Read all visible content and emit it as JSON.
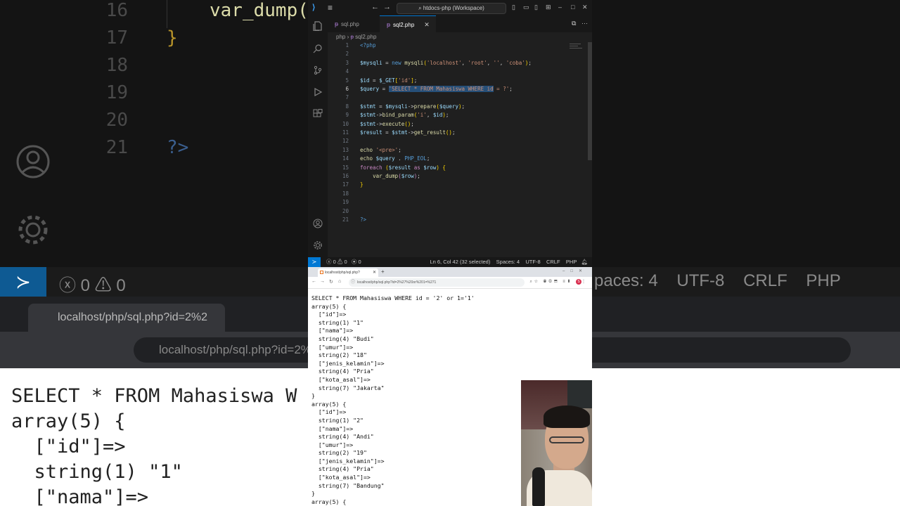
{
  "background": {
    "editor_lines": [
      {
        "num": "16",
        "code": "var_dump("
      },
      {
        "num": "17",
        "code": "}"
      },
      {
        "num": "18",
        "code": ""
      },
      {
        "num": "19",
        "code": ""
      },
      {
        "num": "20",
        "code": ""
      },
      {
        "num": "21",
        "code": "?>"
      }
    ],
    "status_left": "0 ⚠ 0",
    "status_right": "paces: 4    UTF-8    CRLF    PHP",
    "tab_title": "localhost/php/sql.php?id=2%2",
    "url": "localhost/php/sql.php?id=2%",
    "page_text": "SELECT * FROM Mahasiswa W\narray(5) {\n  [\"id\"]=>\n  string(1) \"1\"\n  [\"nama\"]=>"
  },
  "vscode": {
    "search_label": "htdocs-php (Workspace)",
    "tabs": [
      {
        "label": "sql.php",
        "active": false
      },
      {
        "label": "sql2.php",
        "active": true
      }
    ],
    "breadcrumb": {
      "folder": "php",
      "file": "sql2.php"
    },
    "line_numbers": [
      "1",
      "2",
      "3",
      "4",
      "5",
      "6",
      "7",
      "8",
      "9",
      "10",
      "11",
      "12",
      "13",
      "14",
      "15",
      "16",
      "17",
      "18",
      "19",
      "20",
      "21"
    ],
    "current_line": "6",
    "status": {
      "errors": "0",
      "warnings": "0",
      "ports": "0",
      "cursor": "Ln 6, Col 42 (32 selected)",
      "spaces": "Spaces: 4",
      "encoding": "UTF-8",
      "eol": "CRLF",
      "language": "PHP"
    }
  },
  "browser": {
    "tab_title": "localhost/php/sql.php?id=2%27%20or%20...",
    "url": "localhost/php/sql.php?id=2%27%20or%201=%271",
    "profile_initial": "S",
    "output": "SELECT * FROM Mahasiswa WHERE id = '2' or 1='1'\narray(5) {\n  [\"id\"]=>\n  string(1) \"1\"\n  [\"nama\"]=>\n  string(4) \"Budi\"\n  [\"umur\"]=>\n  string(2) \"18\"\n  [\"jenis_kelamin\"]=>\n  string(4) \"Pria\"\n  [\"kota_asal\"]=>\n  string(7) \"Jakarta\"\n}\narray(5) {\n  [\"id\"]=>\n  string(1) \"2\"\n  [\"nama\"]=>\n  string(4) \"Andi\"\n  [\"umur\"]=>\n  string(2) \"19\"\n  [\"jenis_kelamin\"]=>\n  string(4) \"Pria\"\n  [\"kota_asal\"]=>\n  string(7) \"Bandung\"\n}\narray(5) {"
  },
  "colors": {
    "accent": "#0078d4",
    "editor_bg": "#1f1f1f",
    "selection": "#264f78"
  }
}
